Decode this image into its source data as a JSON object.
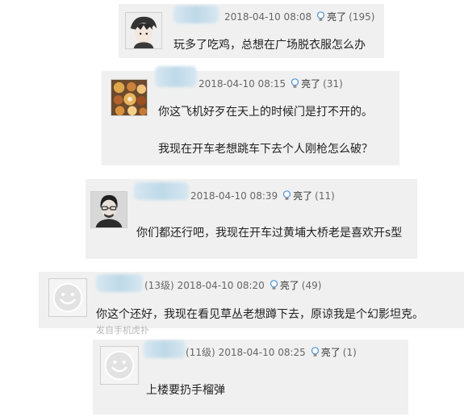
{
  "comments": [
    {
      "date": "2018-04-10 08:08",
      "like_label": "亮了",
      "like_count": "(195)",
      "lines": [
        "玩多了吃鸡，总想在广场脱衣服怎么办"
      ]
    },
    {
      "date": "2018-04-10 08:15",
      "like_label": "亮了",
      "like_count": "(31)",
      "lines": [
        "你这飞机好歹在天上的时候门是打不开的。",
        "我现在开车老想跳车下去个人刚枪怎么破？"
      ]
    },
    {
      "date": "2018-04-10 08:39",
      "like_label": "亮了",
      "like_count": "(11)",
      "lines": [
        "你们都还行吧，我现在开车过黄埔大桥老是喜欢开s型"
      ]
    },
    {
      "level": "(13级)",
      "date": "2018-04-10 08:20",
      "like_label": "亮了",
      "like_count": "(49)",
      "lines": [
        "你这个还好，我现在看见草丛老想蹲下去，原谅我是个幻影坦克。"
      ],
      "footer": "发自手机虎扑"
    },
    {
      "level": "(11级)",
      "date": "2018-04-10 08:25",
      "like_label": "亮了",
      "like_count": "(1)",
      "lines": [
        "上楼要扔手榴弹"
      ]
    }
  ],
  "icons": {
    "like": "lightbulb-icon",
    "avatar_default": "smiley-avatar-icon"
  },
  "colors": {
    "card_bg": "#f0f0f0",
    "meta_text": "#666666",
    "body_text": "#222222",
    "bulb_blue": "#4a90d9"
  }
}
